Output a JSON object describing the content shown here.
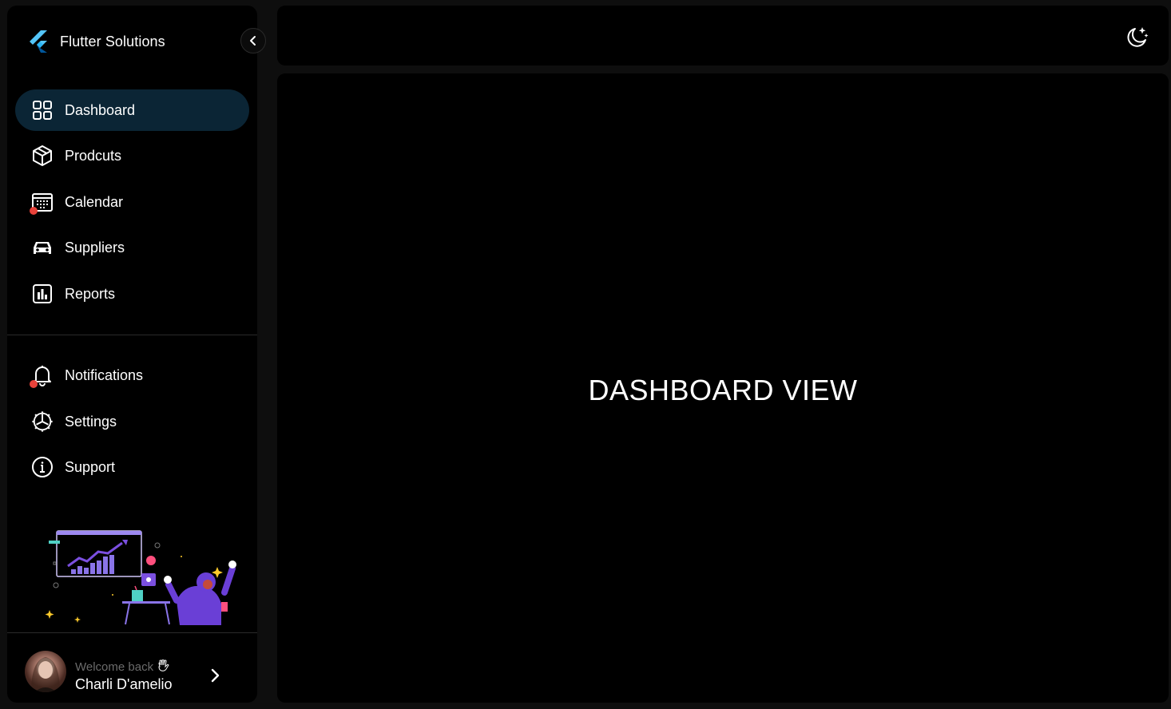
{
  "brand": {
    "title": "Flutter Solutions",
    "logo_icon": "flutter-logo-icon"
  },
  "nav": {
    "primary": [
      {
        "id": "dashboard",
        "label": "Dashboard",
        "icon": "grid-icon",
        "active": true,
        "badge": false
      },
      {
        "id": "products",
        "label": "Prodcuts",
        "icon": "box-icon",
        "active": false,
        "badge": false
      },
      {
        "id": "calendar",
        "label": "Calendar",
        "icon": "calendar-icon",
        "active": false,
        "badge": true
      },
      {
        "id": "suppliers",
        "label": "Suppliers",
        "icon": "car-icon",
        "active": false,
        "badge": false
      },
      {
        "id": "reports",
        "label": "Reports",
        "icon": "bar-chart-icon",
        "active": false,
        "badge": false
      }
    ],
    "secondary": [
      {
        "id": "notifications",
        "label": "Notifications",
        "icon": "bell-icon",
        "active": false,
        "badge": true
      },
      {
        "id": "settings",
        "label": "Settings",
        "icon": "gear-icon",
        "active": false,
        "badge": false
      },
      {
        "id": "support",
        "label": "Support",
        "icon": "info-icon",
        "active": false,
        "badge": false
      }
    ]
  },
  "user": {
    "welcome": "Welcome back",
    "wave_icon": "waving-hand-icon",
    "name": "Charli D'amelio"
  },
  "header": {
    "theme_toggle_icon": "moon-stars-icon"
  },
  "main": {
    "title": "DASHBOARD VIEW"
  },
  "colors": {
    "background": "#0e0e0e",
    "panel": "#000000",
    "active_item": "#0b2535",
    "badge": "#e8423a",
    "text": "#ffffff",
    "muted_text": "#6b6b6b",
    "illustration_accent": "#7b4fe0"
  }
}
